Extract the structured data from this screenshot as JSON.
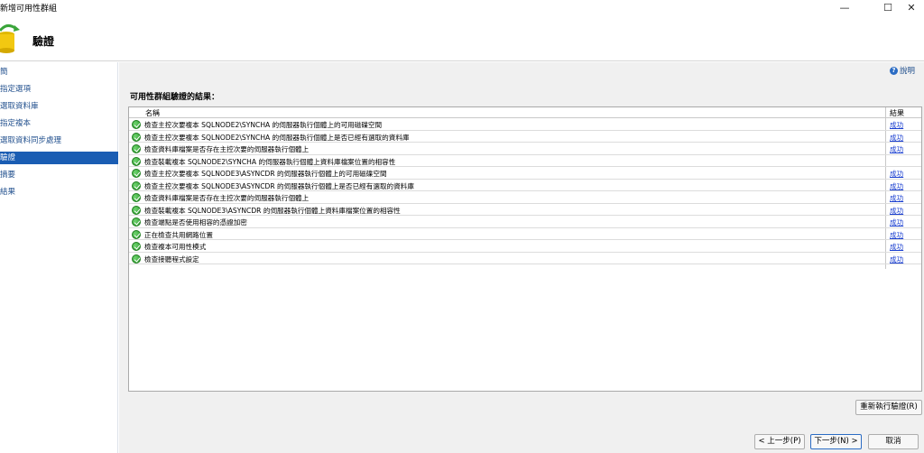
{
  "window": {
    "title": "新增可用性群組",
    "minimize": "—",
    "maximize": "☐",
    "close": "✕"
  },
  "header": {
    "heading": "驗證"
  },
  "sidebar": {
    "items": [
      {
        "label": "簡",
        "active": false
      },
      {
        "label": "指定選項",
        "active": false
      },
      {
        "label": "選取資料庫",
        "active": false
      },
      {
        "label": "指定複本",
        "active": false
      },
      {
        "label": "選取資料同步處理",
        "active": false
      },
      {
        "label": "驗證",
        "active": true
      },
      {
        "label": "摘要",
        "active": false
      },
      {
        "label": "結果",
        "active": false
      }
    ]
  },
  "content": {
    "help_label": "說明",
    "section_title": "可用性群組驗證的結果：",
    "grid": {
      "columns": {
        "name": "名稱",
        "result": "結果"
      },
      "rows": [
        {
          "name": "檢查主控次要複本 SQLNODE2\\SYNCHA 的伺服器執行個體上的可用磁碟空間",
          "result": "成功"
        },
        {
          "name": "檢查主控次要複本 SQLNODE2\\SYNCHA 的伺服器執行個體上是否已經有選取的資料庫",
          "result": "成功"
        },
        {
          "name": "檢查資料庫檔案是否存在主控次要的伺服器執行個體上",
          "result": "成功"
        },
        {
          "name": "檢查裝載複本 SQLNODE2\\SYNCHA 的伺服器執行個體上資料庫檔案位置的相容性",
          "result": ""
        },
        {
          "name": "檢查主控次要複本 SQLNODE3\\ASYNCDR 的伺服器執行個體上的可用磁碟空間",
          "result": "成功"
        },
        {
          "name": "檢查主控次要複本 SQLNODE3\\ASYNCDR 的伺服器執行個體上是否已經有選取的資料庫",
          "result": "成功"
        },
        {
          "name": "檢查資料庫檔案是否存在主控次要的伺服器執行個體上",
          "result": "成功"
        },
        {
          "name": "檢查裝載複本 SQLNODE3\\ASYNCDR 的伺服器執行個體上資料庫檔案位置的相容性",
          "result": "成功"
        },
        {
          "name": "檢查端點是否使用相容的憑證加密",
          "result": "成功"
        },
        {
          "name": "正在檢查共用網路位置",
          "result": "成功"
        },
        {
          "name": "檢查複本可用性模式",
          "result": "成功"
        },
        {
          "name": "檢查接聽程式設定",
          "result": "成功"
        }
      ]
    },
    "rerun_button": "重新執行驗證(R)"
  },
  "footer": {
    "prev_button": "< 上一步(P)",
    "next_button": "下一步(N) >",
    "cancel_button": "取消"
  }
}
